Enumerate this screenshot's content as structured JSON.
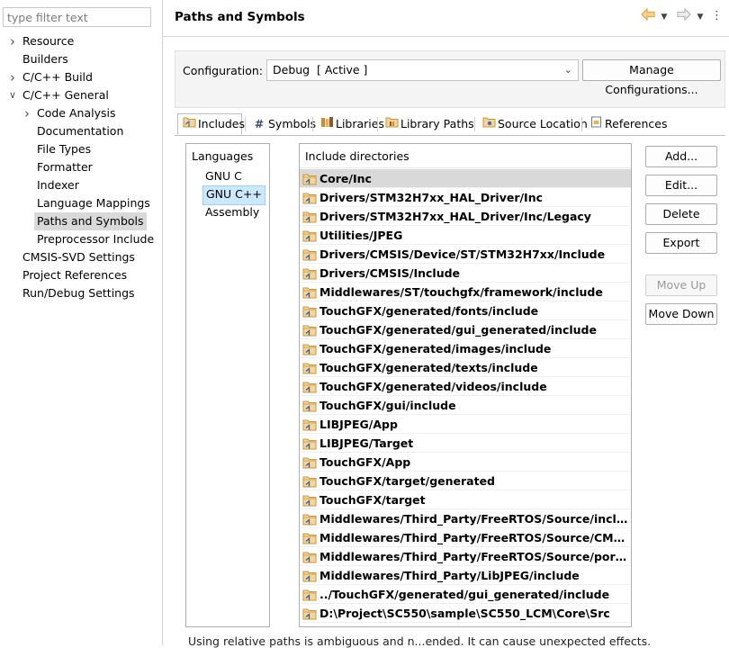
{
  "filter": {
    "placeholder": "type filter text"
  },
  "tree": [
    {
      "label": "Resource",
      "level": 0,
      "expander": "collapsed"
    },
    {
      "label": "Builders",
      "level": 0,
      "expander": "none"
    },
    {
      "label": "C/C++ Build",
      "level": 0,
      "expander": "collapsed"
    },
    {
      "label": "C/C++ General",
      "level": 0,
      "expander": "expanded"
    },
    {
      "label": "Code Analysis",
      "level": 1,
      "expander": "collapsed"
    },
    {
      "label": "Documentation",
      "level": 1,
      "expander": "none"
    },
    {
      "label": "File Types",
      "level": 1,
      "expander": "none"
    },
    {
      "label": "Formatter",
      "level": 1,
      "expander": "none"
    },
    {
      "label": "Indexer",
      "level": 1,
      "expander": "none"
    },
    {
      "label": "Language Mappings",
      "level": 1,
      "expander": "none"
    },
    {
      "label": "Paths and Symbols",
      "level": 1,
      "expander": "none",
      "selected": true
    },
    {
      "label": "Preprocessor Include",
      "level": 1,
      "expander": "none"
    },
    {
      "label": "CMSIS-SVD Settings",
      "level": 0,
      "expander": "none"
    },
    {
      "label": "Project References",
      "level": 0,
      "expander": "none"
    },
    {
      "label": "Run/Debug Settings",
      "level": 0,
      "expander": "none"
    }
  ],
  "page": {
    "title": "Paths and Symbols"
  },
  "nav": {
    "back_icon": "arrow-left-icon",
    "forward_icon": "arrow-right-icon",
    "back_color": "#e8a33a",
    "forward_color": "#b8b8b8"
  },
  "config": {
    "label": "Configuration:",
    "selected": "Debug  [ Active ]",
    "manage_label": "Manage Configurations..."
  },
  "tabs": [
    {
      "label": "Includes",
      "icon": "includes-folder-icon",
      "active": true
    },
    {
      "label": "Symbols",
      "icon": "hash-icon"
    },
    {
      "label": "Libraries",
      "icon": "libraries-icon"
    },
    {
      "label": "Library Paths",
      "icon": "library-paths-icon"
    },
    {
      "label": "Source Location",
      "icon": "source-location-icon"
    },
    {
      "label": "References",
      "icon": "references-icon"
    }
  ],
  "languages": {
    "header": "Languages",
    "items": [
      {
        "label": "GNU C"
      },
      {
        "label": "GNU C++",
        "selected": true
      },
      {
        "label": "Assembly"
      }
    ]
  },
  "includes": {
    "header": "Include directories",
    "items": [
      "Core/Inc",
      "Drivers/STM32H7xx_HAL_Driver/Inc",
      "Drivers/STM32H7xx_HAL_Driver/Inc/Legacy",
      "Utilities/JPEG",
      "Drivers/CMSIS/Device/ST/STM32H7xx/Include",
      "Drivers/CMSIS/Include",
      "Middlewares/ST/touchgfx/framework/include",
      "TouchGFX/generated/fonts/include",
      "TouchGFX/generated/gui_generated/include",
      "TouchGFX/generated/images/include",
      "TouchGFX/generated/texts/include",
      "TouchGFX/generated/videos/include",
      "TouchGFX/gui/include",
      "LIBJPEG/App",
      "LIBJPEG/Target",
      "TouchGFX/App",
      "TouchGFX/target/generated",
      "TouchGFX/target",
      "Middlewares/Third_Party/FreeRTOS/Source/include",
      "Middlewares/Third_Party/FreeRTOS/Source/CMSIS_RT...",
      "Middlewares/Third_Party/FreeRTOS/Source/portable/...",
      "Middlewares/Third_Party/LibJPEG/include",
      "../TouchGFX/generated/gui_generated/include",
      "D:\\Project\\SC550\\sample\\SC550_LCM\\Core\\Src"
    ],
    "selected_index": 0
  },
  "buttons": {
    "add": "Add...",
    "edit": "Edit...",
    "delete": "Delete",
    "export": "Export",
    "move_up": "Move Up",
    "move_down": "Move Down"
  },
  "footnote": "Using relative paths is ambiguous and n...ended. It can cause unexpected effects."
}
